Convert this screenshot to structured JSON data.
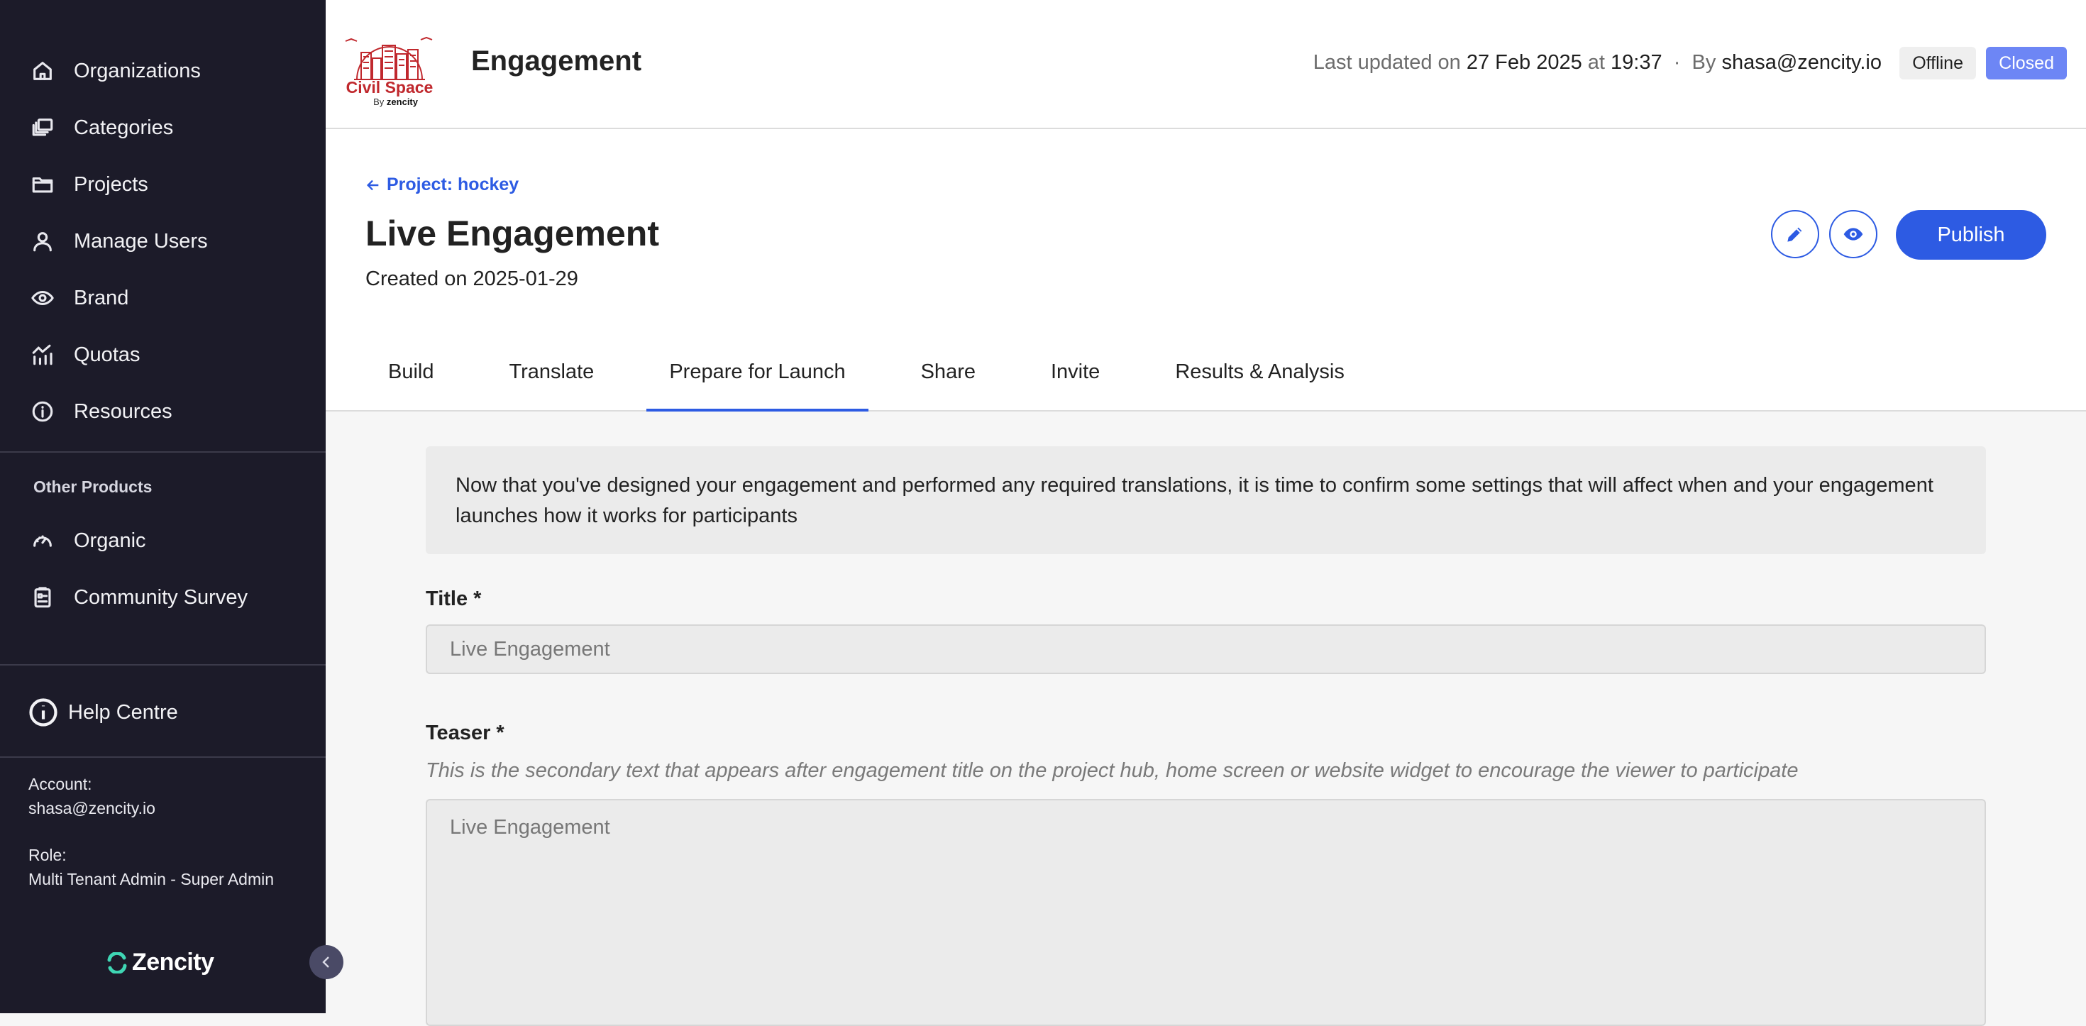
{
  "sidebar": {
    "items": [
      {
        "label": "Organizations",
        "icon": "home-icon"
      },
      {
        "label": "Categories",
        "icon": "stack-icon"
      },
      {
        "label": "Projects",
        "icon": "folder-icon"
      },
      {
        "label": "Manage Users",
        "icon": "user-icon"
      },
      {
        "label": "Brand",
        "icon": "eye-icon"
      },
      {
        "label": "Quotas",
        "icon": "chart-icon"
      },
      {
        "label": "Resources",
        "icon": "info-icon"
      }
    ],
    "other_products_label": "Other Products",
    "other_products": [
      {
        "label": "Organic",
        "icon": "gauge-icon"
      },
      {
        "label": "Community Survey",
        "icon": "clipboard-icon"
      }
    ],
    "help_label": "Help Centre",
    "account_label": "Account:",
    "account_value": "shasa@zencity.io",
    "role_label": "Role:",
    "role_value": "Multi Tenant Admin - Super Admin",
    "logo_text": "Zencity"
  },
  "header": {
    "logo_name": "Civil Space",
    "logo_by": "By",
    "logo_by_brand": "zencity",
    "title": "Engagement",
    "meta_prefix": "Last updated on",
    "meta_date": "27 Feb 2025",
    "meta_at": "at",
    "meta_time": "19:37",
    "meta_sep": "·",
    "meta_by": "By",
    "meta_user": "shasa@zencity.io",
    "badge_offline": "Offline",
    "badge_closed": "Closed"
  },
  "page": {
    "back_link": "Project: hockey",
    "title": "Live Engagement",
    "created": "Created on 2025-01-29",
    "publish_label": "Publish",
    "tabs": [
      "Build",
      "Translate",
      "Prepare for Launch",
      "Share",
      "Invite",
      "Results & Analysis"
    ],
    "active_tab": "Prepare for Launch"
  },
  "content": {
    "notice": "Now that you've designed your engagement and performed any required translations, it is time to confirm some settings that will affect when and your engagement launches how it works for participants",
    "title_label": "Title *",
    "title_value": "Live Engagement",
    "teaser_label": "Teaser *",
    "teaser_hint": "This is the secondary text that appears after engagement title on the project hub, home screen or website widget to encourage the viewer to participate",
    "teaser_value": "Live Engagement"
  },
  "colors": {
    "sidebar_bg": "#1c1b29",
    "accent": "#2d5be3",
    "closed_badge": "#6d86f5"
  }
}
